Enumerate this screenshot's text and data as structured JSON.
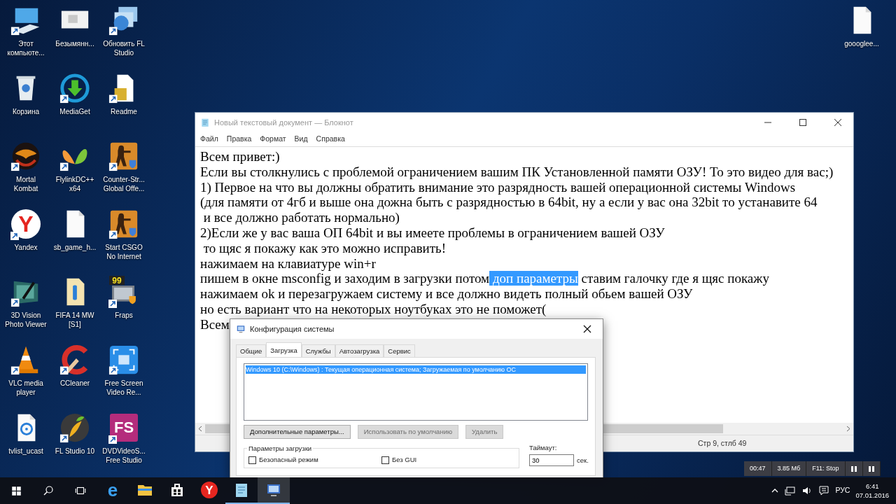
{
  "desktop_icons": [
    {
      "label": "Этот компьюте...",
      "kind": "computer",
      "shortcut": true
    },
    {
      "label": "Корзина",
      "kind": "recycle",
      "shortcut": false
    },
    {
      "label": "Mortal Kombat",
      "kind": "mortal",
      "shortcut": true
    },
    {
      "label": "Yandex",
      "kind": "yandex",
      "shortcut": true,
      "logo_text": "Y"
    },
    {
      "label": "3D Vision Photo Viewer",
      "kind": "vision",
      "shortcut": true
    },
    {
      "label": "VLC media player",
      "kind": "cone",
      "shortcut": true
    },
    {
      "label": "tvlist_ucast",
      "kind": "disc",
      "shortcut": false
    },
    {
      "label": "Безымянн...",
      "kind": "window",
      "shortcut": false
    },
    {
      "label": "MediaGet",
      "kind": "mediaget",
      "shortcut": true
    },
    {
      "label": "FlylinkDC++ x64",
      "kind": "butterfly",
      "shortcut": true
    },
    {
      "label": "sb_game_h...",
      "kind": "file",
      "shortcut": false
    },
    {
      "label": "FIFA 14 MW [S1]",
      "kind": "folderfile",
      "shortcut": false
    },
    {
      "label": "CCleaner",
      "kind": "ccleaner",
      "shortcut": true
    },
    {
      "label": "FL Studio 10",
      "kind": "fl",
      "shortcut": true
    },
    {
      "label": "Обновить FL Studio",
      "kind": "update",
      "shortcut": true
    },
    {
      "label": "Readme",
      "kind": "docshortcut",
      "shortcut": true
    },
    {
      "label": "Counter-Str... Global Offe...",
      "kind": "soldier",
      "shortcut": true
    },
    {
      "label": "Start CSGO No Internet",
      "kind": "soldier",
      "shortcut": true
    },
    {
      "label": "Fraps",
      "kind": "fraps",
      "shortcut": true,
      "logo_text": "99"
    },
    {
      "label": "Free Screen Video Re...",
      "kind": "screenrec",
      "shortcut": true
    },
    {
      "label": "DVDVideoS... Free Studio",
      "kind": "fs",
      "shortcut": true,
      "logo_text": "FS"
    }
  ],
  "desktop_icons_right": [
    {
      "label": "goooglee...",
      "kind": "file",
      "shortcut": false
    }
  ],
  "notepad": {
    "title": "Новый текстовый документ — Блокнот",
    "menu": [
      "Файл",
      "Правка",
      "Формат",
      "Вид",
      "Справка"
    ],
    "lines": [
      {
        "segments": [
          {
            "text": "Всем привет:)",
            "selected": false
          }
        ]
      },
      {
        "segments": [
          {
            "text": "Если вы столкнулись с проблемой ограничением вашим ПК Установленной памяти ОЗУ! То это видео для вас;)",
            "selected": false
          }
        ]
      },
      {
        "segments": [
          {
            "text": "1) Первое на что вы должны обратить внимание это разрядность вашей операционной системы Windows",
            "selected": false
          }
        ]
      },
      {
        "segments": [
          {
            "text": "(для памяти от 4гб и выше она дожна быть с разрядностью в 64bit, ну а если у вас она 32bit то устанавите 64",
            "selected": false
          }
        ]
      },
      {
        "segments": [
          {
            "text": " и все должно работать нормально)",
            "selected": false
          }
        ]
      },
      {
        "segments": [
          {
            "text": "2)Если же у вас ваша ОП 64bit и вы имеете проблемы в ограничением вашей ОЗУ",
            "selected": false
          }
        ]
      },
      {
        "segments": [
          {
            "text": " то щяс я покажу как это можно исправить!",
            "selected": false
          }
        ]
      },
      {
        "segments": [
          {
            "text": "нажимаем на клавиатуре win+r",
            "selected": false
          }
        ]
      },
      {
        "segments": [
          {
            "text": "пишем в окне msconfig и заходим в загрузки потом",
            "selected": false
          },
          {
            "text": " доп параметры",
            "selected": true
          },
          {
            "text": " ставим галочку где я щяс покажу",
            "selected": false
          }
        ]
      },
      {
        "segments": [
          {
            "text": "нажимаем ok и перезагружаем систему и все должно видеть полный обьем вашей ОЗУ",
            "selected": false
          }
        ]
      },
      {
        "segments": [
          {
            "text": "но есть вариант что на некоторых ноутбуках это не поможет(",
            "selected": false
          }
        ]
      },
      {
        "segments": [
          {
            "text": "Всем",
            "selected": false
          }
        ]
      }
    ],
    "status": "Стр 9, стлб 49"
  },
  "dialog": {
    "title": "Конфигурация системы",
    "tabs": [
      {
        "label": "Общие",
        "selected": false
      },
      {
        "label": "Загрузка",
        "selected": true
      },
      {
        "label": "Службы",
        "selected": false
      },
      {
        "label": "Автозагрузка",
        "selected": false
      },
      {
        "label": "Сервис",
        "selected": false
      }
    ],
    "boot_entries": [
      {
        "text": "Windows 10 (C:\\Windows) : Текущая операционная система; Загружаемая по умолчанию ОС",
        "selected": true
      }
    ],
    "buttons": [
      {
        "label": "Дополнительные параметры...",
        "disabled": false
      },
      {
        "label": "Использовать по умолчанию",
        "disabled": true
      },
      {
        "label": "Удалить",
        "disabled": true
      }
    ],
    "group_title": "Параметры загрузки",
    "options": [
      {
        "label": "Безопасный режим",
        "checked": false
      },
      {
        "label": "Без GUI",
        "checked": false
      }
    ],
    "timeout_label": "Таймаут:",
    "timeout_value": "30",
    "timeout_unit": "сек."
  },
  "recorder": {
    "time": "00:47",
    "size": "3.85 Мб",
    "hotkey": "F11: Stop"
  },
  "taskbar": {
    "apps": [
      {
        "kind": "edge",
        "logo_text": "e",
        "open": false,
        "selected": false
      },
      {
        "kind": "explorer",
        "open": false,
        "selected": false
      },
      {
        "kind": "store",
        "open": false,
        "selected": false
      },
      {
        "kind": "yandex",
        "logo_text": "Y",
        "open": false,
        "selected": false
      },
      {
        "kind": "notepad",
        "open": true,
        "selected": false
      },
      {
        "kind": "msconfig",
        "open": true,
        "selected": true
      }
    ],
    "language": "РУС",
    "time": "6:41",
    "date": "07.01.2016"
  }
}
